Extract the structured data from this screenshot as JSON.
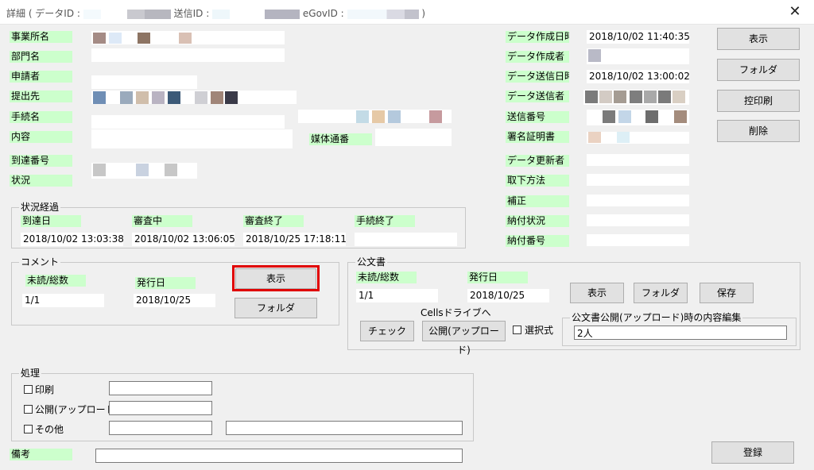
{
  "title": {
    "prefix": "詳細 ( データID :",
    "send_id": "送信ID :",
    "egov_id": "eGovID :",
    "suffix": ")"
  },
  "close_glyph": "✕",
  "left_labels": {
    "office": "事業所名",
    "dept": "部門名",
    "applicant": "申請者",
    "submit_to": "提出先",
    "procedure": "手続名",
    "content": "内容",
    "media_no": "媒体通番",
    "arrival_no": "到達番号",
    "status": "状況"
  },
  "right_labels": {
    "created_at": "データ作成日時",
    "creator": "データ作成者",
    "sent_at": "データ送信日時",
    "sender": "データ送信者",
    "send_no": "送信番号",
    "cert": "署名証明書",
    "updater": "データ更新者",
    "withdraw": "取下方法",
    "correction": "補正",
    "payment_status": "納付状況",
    "payment_no": "納付番号"
  },
  "right_values": {
    "created_at": "2018/10/02 11:40:35",
    "sent_at": "2018/10/02 13:00:02"
  },
  "top_buttons": {
    "show": "表示",
    "folder": "フォルダ",
    "copy_print": "控印刷",
    "delete": "削除"
  },
  "progress": {
    "group_title": "状況経過",
    "labels": [
      "到達日",
      "審査中",
      "審査終了",
      "手続終了"
    ],
    "values": [
      "2018/10/02 13:03:38",
      "2018/10/02 13:06:05",
      "2018/10/25 17:18:11",
      ""
    ]
  },
  "comment": {
    "group_title": "コメント",
    "unread_label": "未読/総数",
    "issue_label": "発行日",
    "unread_value": "1/1",
    "issue_value": "2018/10/25",
    "show_btn": "表示",
    "folder_btn": "フォルダ"
  },
  "official": {
    "group_title": "公文書",
    "unread_label": "未読/総数",
    "issue_label": "発行日",
    "unread_value": "1/1",
    "issue_value": "2018/10/25",
    "show_btn": "表示",
    "folder_btn": "フォルダ",
    "save_btn": "保存",
    "cells_label": "Cellsドライブへ",
    "check_btn": "チェック",
    "publish_btn": "公開(アップロード)",
    "select_label": "選択式",
    "edit_group_title": "公文書公開(アップロード)時の内容編集",
    "edit_value": "2人"
  },
  "process": {
    "group_title": "処理",
    "print_label": "印刷",
    "publish_label": "公開(アップロード)",
    "other_label": "その他"
  },
  "remarks_label": "備考",
  "register_btn": "登録"
}
